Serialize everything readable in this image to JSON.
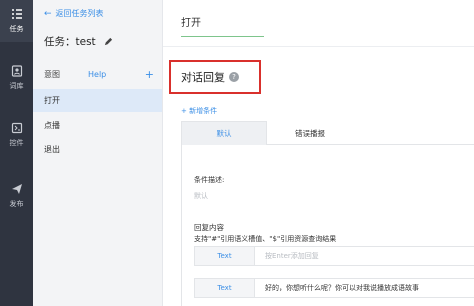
{
  "rail": {
    "items": [
      {
        "label": "任务",
        "icon": "task-list-icon"
      },
      {
        "label": "词库",
        "icon": "dictionary-icon"
      },
      {
        "label": "控件",
        "icon": "widget-icon"
      },
      {
        "label": "发布",
        "icon": "send-icon"
      }
    ]
  },
  "sidebar": {
    "back_link": "返回任务列表",
    "task_title": "任务：test",
    "intent_label": "意图",
    "help_link": "Help",
    "add_symbol": "+",
    "items": [
      {
        "label": "打开",
        "active": true
      },
      {
        "label": "点播",
        "active": false
      },
      {
        "label": "退出",
        "active": false
      }
    ]
  },
  "main": {
    "intent_name": "打开",
    "section_title": "对话回复",
    "help_symbol": "?",
    "add_condition": "+ 新增条件",
    "tabs": [
      {
        "label": "默认",
        "active": true
      },
      {
        "label": "错误播报",
        "active": false
      }
    ],
    "condition_label": "条件描述:",
    "condition_placeholder": "默认",
    "reply_label": "回复内容",
    "support_text": "支持\"#\"引用语义槽值、\"$\"引用资源查询结果",
    "reply_rows": [
      {
        "tag": "Text",
        "value": "按Enter添加回复",
        "placeholder": true
      },
      {
        "tag": "Text",
        "value": "好的，你想听什么呢？你可以对我说播放成语故事",
        "placeholder": false
      }
    ]
  },
  "colors": {
    "rail_bg": "#2f3440",
    "accent_blue": "#3a8ee6",
    "highlight_red": "#d9302c",
    "underline_green": "#7ec58c"
  }
}
